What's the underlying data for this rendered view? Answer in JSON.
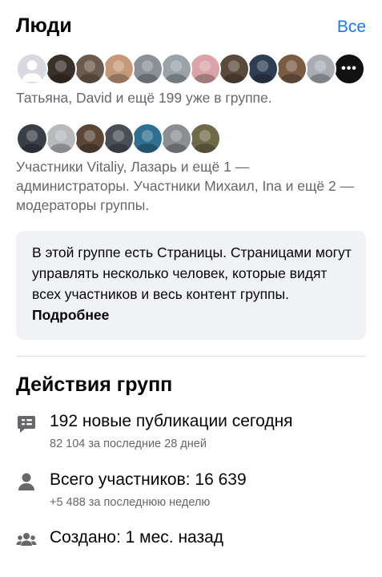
{
  "people": {
    "title": "Люди",
    "see_all": "Все",
    "members_avatars": [
      {
        "name": "default-avatar",
        "color": "#d8dadf"
      },
      {
        "name": "member-avatar",
        "color": "#3b2f2a"
      },
      {
        "name": "member-avatar",
        "color": "#6b5a4e"
      },
      {
        "name": "member-avatar",
        "color": "#c59a7a"
      },
      {
        "name": "member-avatar",
        "color": "#8b8f96"
      },
      {
        "name": "member-avatar",
        "color": "#9aa3a8"
      },
      {
        "name": "member-avatar",
        "color": "#d9a3a8"
      },
      {
        "name": "member-avatar",
        "color": "#5a4a3c"
      },
      {
        "name": "member-avatar",
        "color": "#2f3d52"
      },
      {
        "name": "member-avatar",
        "color": "#7a5b44"
      },
      {
        "name": "member-avatar",
        "color": "#a9acb2"
      }
    ],
    "more_label": "•••",
    "members_text": "Татьяна, David и ещё 199 уже в группе.",
    "staff_avatars": [
      {
        "name": "admin-avatar",
        "color": "#3a3f47"
      },
      {
        "name": "admin-avatar",
        "color": "#b7b9bd"
      },
      {
        "name": "moderator-avatar",
        "color": "#5b4637"
      },
      {
        "name": "moderator-avatar",
        "color": "#4a4f57"
      },
      {
        "name": "moderator-avatar",
        "color": "#2f6f8f"
      },
      {
        "name": "moderator-avatar",
        "color": "#8b8e93"
      },
      {
        "name": "moderator-avatar",
        "color": "#6e6a48"
      }
    ],
    "staff_text": "Участники Vitaliy, Лазарь и ещё 1 — администраторы. Участники Михаил, Ina и ещё 2 — модераторы группы."
  },
  "info": {
    "text": "В этой группе есть Страницы. Страницами могут управлять несколько человек, которые видят всех участников и весь контент группы. ",
    "link": "Подробнее"
  },
  "activity": {
    "title": "Действия групп",
    "posts": {
      "main": "192 новые публикации сегодня",
      "sub": "82 104 за последние 28 дней"
    },
    "members": {
      "main": "Всего участников: 16 639",
      "sub": "+5 488 за последнюю неделю"
    },
    "created": {
      "main": "Создано: 1 мес. назад"
    }
  },
  "colors": {
    "accent": "#1877f2",
    "text": "#050505",
    "secondary": "#65676b",
    "box": "#f0f2f5",
    "icon": "#65676b"
  }
}
